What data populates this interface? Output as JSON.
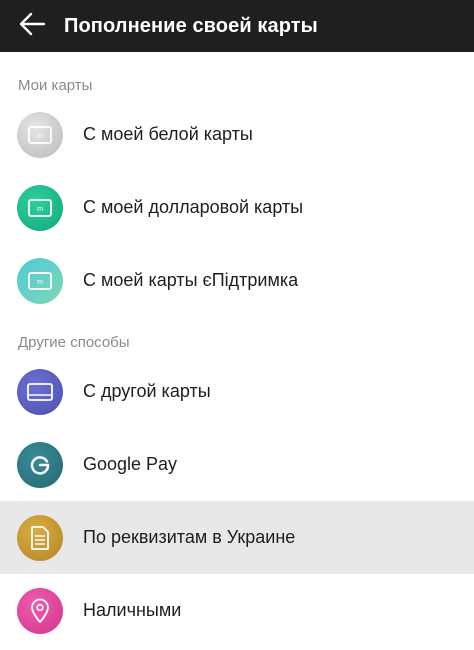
{
  "header": {
    "title": "Пополнение своей карты",
    "back_icon": "arrow-left-icon"
  },
  "sections": [
    {
      "label": "Мои карты",
      "items": [
        {
          "label": "С моей белой карты",
          "icon": "card-icon",
          "color": "#c9c9c9"
        },
        {
          "label": "С моей долларовой карты",
          "icon": "card-icon",
          "color": "#19b989"
        },
        {
          "label": "С моей карты єПідтримка",
          "icon": "card-icon",
          "color": "#5ccfd0"
        }
      ]
    },
    {
      "label": "Другие способы",
      "items": [
        {
          "label": "С другой карты",
          "icon": "card-outline-icon",
          "color": "#5a5fc2"
        },
        {
          "label": "Google Pay",
          "icon": "google-g-icon",
          "color": "#2d7a86"
        },
        {
          "label": "По реквизитам в Украине",
          "icon": "document-icon",
          "color": "#c99a2e",
          "selected": true
        },
        {
          "label": "Наличными",
          "icon": "location-pin-icon",
          "color": "#e2459c"
        }
      ]
    }
  ]
}
